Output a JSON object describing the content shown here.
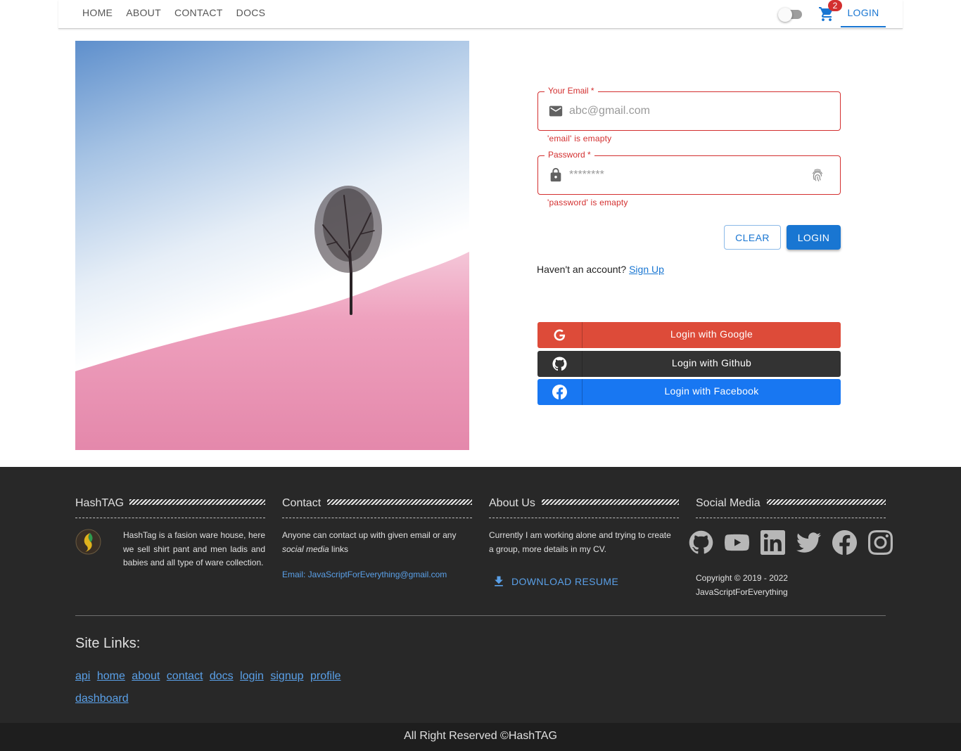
{
  "nav": {
    "items": [
      {
        "label": "HOME"
      },
      {
        "label": "ABOUT"
      },
      {
        "label": "CONTACT"
      },
      {
        "label": "DOCS"
      }
    ],
    "cart_count": "2",
    "login_label": "LOGIN",
    "theme_toggle_on": false
  },
  "form": {
    "email": {
      "label": "Your Email *",
      "placeholder": "abc@gmail.com",
      "value": "",
      "error": "'email' is emapty",
      "icon": "mail-icon"
    },
    "password": {
      "label": "Password *",
      "placeholder": "********",
      "value": "",
      "error": "'password' is emapty",
      "icon": "lock-icon",
      "adornment_icon": "fingerprint-icon"
    },
    "clear_label": "CLEAR",
    "login_label": "LOGIN",
    "signup_prompt": "Haven't an account?",
    "signup_link": "Sign Up"
  },
  "social_login": [
    {
      "label": "Login with Google",
      "icon": "google-icon",
      "color": "#dd4b39"
    },
    {
      "label": "Login with Github",
      "icon": "github-icon",
      "color": "#333333"
    },
    {
      "label": "Login with Facebook",
      "icon": "facebook-icon",
      "color": "#1877f2"
    }
  ],
  "footer": {
    "hashtag": {
      "title": "HashTAG",
      "text": "HashTag is a fasion ware house, here we sell shirt pant and men ladis and babies and all type of ware collection."
    },
    "contact": {
      "title": "Contact",
      "text_before": "Anyone can contact up with given email or any ",
      "text_em": "social media",
      "text_after": " links",
      "email": "Email: JavaScriptForEverything@gmail.com"
    },
    "about": {
      "title": "About Us",
      "text": "Currently I am working alone and trying to create a group, more details in my CV.",
      "download_label": "DOWNLOAD RESUME"
    },
    "social": {
      "title": "Social Media",
      "icons": [
        "github-icon",
        "youtube-icon",
        "linkedin-icon",
        "twitter-icon",
        "facebook-icon",
        "instagram-icon"
      ],
      "copyright_line1": "Copyright © 2019 - 2022",
      "copyright_line2": "JavaScriptForEverything"
    },
    "site_links_title": "Site Links:",
    "site_links": [
      "api",
      "home",
      "about",
      "contact",
      "docs",
      "login",
      "signup",
      "profile",
      "dashboard"
    ],
    "bottom_text": "All Right Reserved ©HashTAG"
  },
  "colors": {
    "primary": "#1976d2",
    "error": "#d32f2f",
    "footer_bg": "#282828",
    "link": "#5aa0e8"
  }
}
